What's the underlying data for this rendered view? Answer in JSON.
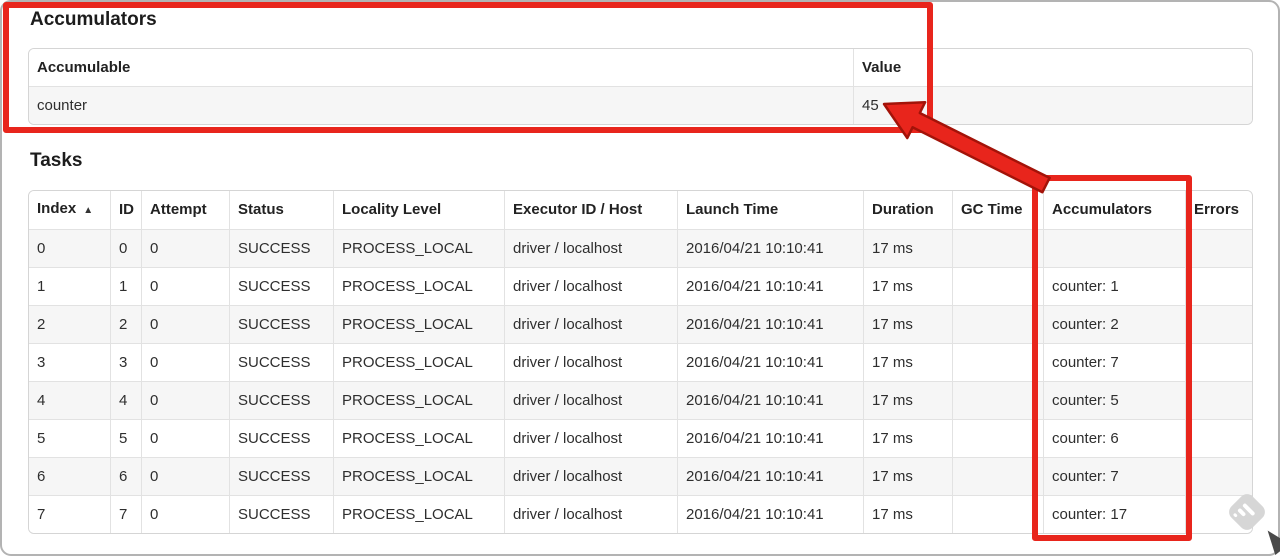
{
  "accumulators": {
    "heading": "Accumulators",
    "col_headers": [
      "Accumulable",
      "Value"
    ],
    "rows": [
      {
        "accumulable": "counter",
        "value": "45"
      }
    ]
  },
  "tasks": {
    "heading": "Tasks",
    "col_headers": {
      "index": "Index",
      "index_sort": "▲",
      "id": "ID",
      "attempt": "Attempt",
      "status": "Status",
      "locality_level": "Locality Level",
      "executor_id_host": "Executor ID / Host",
      "launch_time": "Launch Time",
      "duration": "Duration",
      "gc_time": "GC Time",
      "accumulators": "Accumulators",
      "errors": "Errors"
    },
    "rows": [
      {
        "index": "0",
        "id": "0",
        "attempt": "0",
        "status": "SUCCESS",
        "locality_level": "PROCESS_LOCAL",
        "executor_id_host": "driver / localhost",
        "launch_time": "2016/04/21 10:10:41",
        "duration": "17 ms",
        "gc_time": "",
        "accumulators": "",
        "errors": ""
      },
      {
        "index": "1",
        "id": "1",
        "attempt": "0",
        "status": "SUCCESS",
        "locality_level": "PROCESS_LOCAL",
        "executor_id_host": "driver / localhost",
        "launch_time": "2016/04/21 10:10:41",
        "duration": "17 ms",
        "gc_time": "",
        "accumulators": "counter: 1",
        "errors": ""
      },
      {
        "index": "2",
        "id": "2",
        "attempt": "0",
        "status": "SUCCESS",
        "locality_level": "PROCESS_LOCAL",
        "executor_id_host": "driver / localhost",
        "launch_time": "2016/04/21 10:10:41",
        "duration": "17 ms",
        "gc_time": "",
        "accumulators": "counter: 2",
        "errors": ""
      },
      {
        "index": "3",
        "id": "3",
        "attempt": "0",
        "status": "SUCCESS",
        "locality_level": "PROCESS_LOCAL",
        "executor_id_host": "driver / localhost",
        "launch_time": "2016/04/21 10:10:41",
        "duration": "17 ms",
        "gc_time": "",
        "accumulators": "counter: 7",
        "errors": ""
      },
      {
        "index": "4",
        "id": "4",
        "attempt": "0",
        "status": "SUCCESS",
        "locality_level": "PROCESS_LOCAL",
        "executor_id_host": "driver / localhost",
        "launch_time": "2016/04/21 10:10:41",
        "duration": "17 ms",
        "gc_time": "",
        "accumulators": "counter: 5",
        "errors": ""
      },
      {
        "index": "5",
        "id": "5",
        "attempt": "0",
        "status": "SUCCESS",
        "locality_level": "PROCESS_LOCAL",
        "executor_id_host": "driver / localhost",
        "launch_time": "2016/04/21 10:10:41",
        "duration": "17 ms",
        "gc_time": "",
        "accumulators": "counter: 6",
        "errors": ""
      },
      {
        "index": "6",
        "id": "6",
        "attempt": "0",
        "status": "SUCCESS",
        "locality_level": "PROCESS_LOCAL",
        "executor_id_host": "driver / localhost",
        "launch_time": "2016/04/21 10:10:41",
        "duration": "17 ms",
        "gc_time": "",
        "accumulators": "counter: 7",
        "errors": ""
      },
      {
        "index": "7",
        "id": "7",
        "attempt": "0",
        "status": "SUCCESS",
        "locality_level": "PROCESS_LOCAL",
        "executor_id_host": "driver / localhost",
        "launch_time": "2016/04/21 10:10:41",
        "duration": "17 ms",
        "gc_time": "",
        "accumulators": "counter: 17",
        "errors": ""
      }
    ]
  },
  "annotations": {
    "color": "#e8251c",
    "arrow_outline_color": "#a31309"
  },
  "watermark_color": "#d6d6d6",
  "frame_color": "#b3b3b3"
}
